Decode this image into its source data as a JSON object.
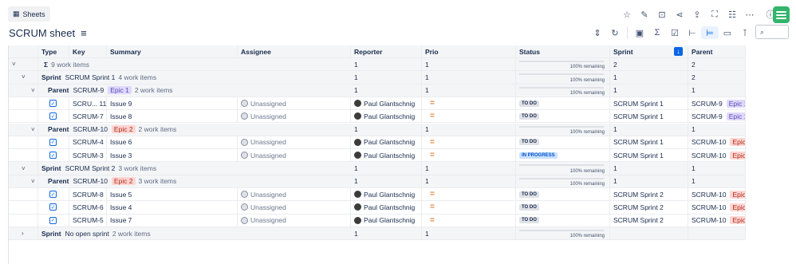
{
  "sheets_label": "Sheets",
  "title": "SCRUM sheet",
  "columns": [
    "Type",
    "Key",
    "Summary",
    "Assignee",
    "Reporter",
    "Prio",
    "Status",
    "Sprint",
    "Parent"
  ],
  "rows": [
    {
      "kind": "grp",
      "level": 0,
      "chev": "˅",
      "tlabel": "Σ",
      "text": "9 work items",
      "reporter": "1",
      "prio": "1",
      "remaining": "100% remaining",
      "sprint": "2",
      "parent": "2"
    },
    {
      "kind": "grp",
      "level": 1,
      "chev": "˅",
      "tlabel": "Sprint",
      "name": "SCRUM Sprint 1",
      "text": "4 work items",
      "reporter": "1",
      "prio": "1",
      "remaining": "100% remaining",
      "sprint": "1",
      "parent": "2"
    },
    {
      "kind": "grp",
      "level": 2,
      "chev": "˅",
      "tlabel": "Parent",
      "name": "SCRUM-9",
      "epic": "Epic 1",
      "epic_color": "purple",
      "text": "2 work items",
      "reporter": "1",
      "prio": "1",
      "remaining": "100% remaining",
      "sprint": "1",
      "parent": "1"
    },
    {
      "kind": "item",
      "key": "SCRU... 11",
      "summary": "Issue 9",
      "assignee": "Unassigned",
      "reporter": "Paul Glantschnig",
      "prio": "=",
      "status": "TO DO",
      "sprint": "SCRUM Sprint 1",
      "pkey": "SCRUM-9",
      "pepic": "Epic 1",
      "epic_color": "purple"
    },
    {
      "kind": "item",
      "key": "SCRUM-7",
      "summary": "Issue 8",
      "assignee": "Unassigned",
      "reporter": "Paul Glantschnig",
      "prio": "=",
      "status": "TO DO",
      "sprint": "SCRUM Sprint 1",
      "pkey": "SCRUM-9",
      "pepic": "Epic 1",
      "epic_color": "purple"
    },
    {
      "kind": "grp",
      "level": 2,
      "chev": "˅",
      "tlabel": "Parent",
      "name": "SCRUM-10",
      "epic": "Epic 2",
      "epic_color": "red",
      "text": "2 work items",
      "reporter": "1",
      "prio": "1",
      "remaining": "100% remaining",
      "sprint": "1",
      "parent": "1"
    },
    {
      "kind": "item",
      "key": "SCRUM-4",
      "summary": "Issue 6",
      "assignee": "Unassigned",
      "reporter": "Paul Glantschnig",
      "prio": "=",
      "status": "TO DO",
      "sprint": "SCRUM Sprint 1",
      "pkey": "SCRUM-10",
      "pepic": "Epic 2",
      "epic_color": "red"
    },
    {
      "kind": "item",
      "key": "SCRUM-3",
      "summary": "Issue 3",
      "assignee": "Unassigned",
      "reporter": "Paul Glantschnig",
      "prio": "=",
      "status": "IN PROGRESS",
      "sprint": "SCRUM Sprint 1",
      "pkey": "SCRUM-10",
      "pepic": "Epic 2",
      "epic_color": "red"
    },
    {
      "kind": "grp",
      "level": 1,
      "chev": "˅",
      "tlabel": "Sprint",
      "name": "SCRUM Sprint 2",
      "text": "3 work items",
      "reporter": "1",
      "prio": "1",
      "remaining": "100% remaining",
      "sprint": "1",
      "parent": "1"
    },
    {
      "kind": "grp",
      "level": 2,
      "chev": "˅",
      "tlabel": "Parent",
      "name": "SCRUM-10",
      "epic": "Epic 2",
      "epic_color": "red",
      "text": "3 work items",
      "reporter": "1",
      "prio": "1",
      "remaining": "100% remaining",
      "sprint": "1",
      "parent": "1"
    },
    {
      "kind": "item",
      "key": "SCRUM-8",
      "summary": "Issue 5",
      "assignee": "Unassigned",
      "reporter": "Paul Glantschnig",
      "prio": "=",
      "status": "TO DO",
      "sprint": "SCRUM Sprint 2",
      "pkey": "SCRUM-10",
      "pepic": "Epic 2",
      "epic_color": "red"
    },
    {
      "kind": "item",
      "key": "SCRUM-6",
      "summary": "Issue 4",
      "assignee": "Unassigned",
      "reporter": "Paul Glantschnig",
      "prio": "=",
      "status": "TO DO",
      "sprint": "SCRUM Sprint 2",
      "pkey": "SCRUM-10",
      "pepic": "Epic 2",
      "epic_color": "red"
    },
    {
      "kind": "item",
      "key": "SCRUM-5",
      "summary": "Issue 7",
      "assignee": "Unassigned",
      "reporter": "Paul Glantschnig",
      "prio": "=",
      "status": "TO DO",
      "sprint": "SCRUM Sprint 2",
      "pkey": "SCRUM-10",
      "pepic": "Epic 2",
      "epic_color": "red"
    },
    {
      "kind": "grp",
      "level": 1,
      "chev": "›",
      "tlabel": "Sprint",
      "name": "No open sprint",
      "text": "2 work items",
      "reporter": "1",
      "prio": "1",
      "remaining": "100% remaining",
      "sprint": "",
      "parent": ""
    }
  ],
  "colors": {
    "accent": "#0c66e4",
    "todo": "#dfe1e6",
    "inprogress": "#cce0ff",
    "epic_red": "#ffd5d2",
    "epic_purple": "#dfd8fd",
    "logo": "#33b56b"
  }
}
